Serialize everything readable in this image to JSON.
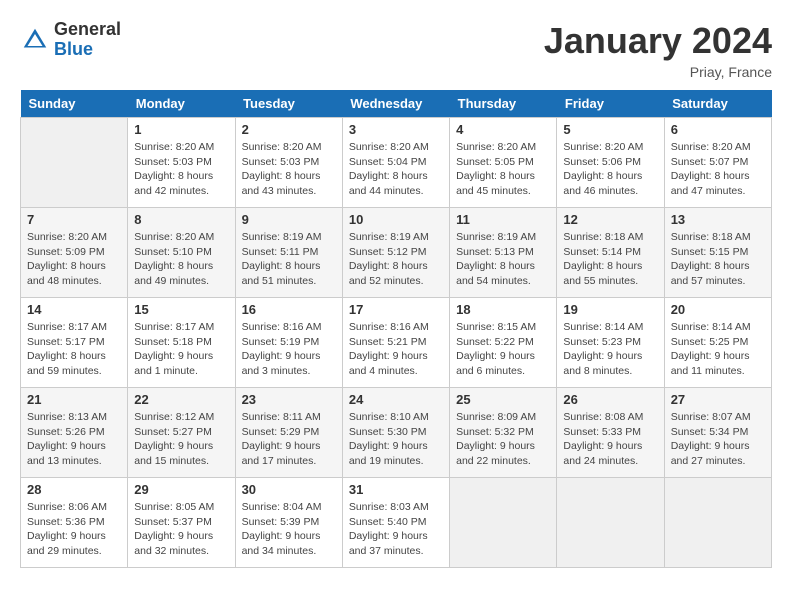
{
  "header": {
    "title": "January 2024",
    "location": "Priay, France",
    "logo_general": "General",
    "logo_blue": "Blue"
  },
  "days_of_week": [
    "Sunday",
    "Monday",
    "Tuesday",
    "Wednesday",
    "Thursday",
    "Friday",
    "Saturday"
  ],
  "weeks": [
    [
      {
        "date": "",
        "info": ""
      },
      {
        "date": "1",
        "info": "Sunrise: 8:20 AM\nSunset: 5:03 PM\nDaylight: 8 hours\nand 42 minutes."
      },
      {
        "date": "2",
        "info": "Sunrise: 8:20 AM\nSunset: 5:03 PM\nDaylight: 8 hours\nand 43 minutes."
      },
      {
        "date": "3",
        "info": "Sunrise: 8:20 AM\nSunset: 5:04 PM\nDaylight: 8 hours\nand 44 minutes."
      },
      {
        "date": "4",
        "info": "Sunrise: 8:20 AM\nSunset: 5:05 PM\nDaylight: 8 hours\nand 45 minutes."
      },
      {
        "date": "5",
        "info": "Sunrise: 8:20 AM\nSunset: 5:06 PM\nDaylight: 8 hours\nand 46 minutes."
      },
      {
        "date": "6",
        "info": "Sunrise: 8:20 AM\nSunset: 5:07 PM\nDaylight: 8 hours\nand 47 minutes."
      }
    ],
    [
      {
        "date": "7",
        "info": "Sunrise: 8:20 AM\nSunset: 5:09 PM\nDaylight: 8 hours\nand 48 minutes."
      },
      {
        "date": "8",
        "info": "Sunrise: 8:20 AM\nSunset: 5:10 PM\nDaylight: 8 hours\nand 49 minutes."
      },
      {
        "date": "9",
        "info": "Sunrise: 8:19 AM\nSunset: 5:11 PM\nDaylight: 8 hours\nand 51 minutes."
      },
      {
        "date": "10",
        "info": "Sunrise: 8:19 AM\nSunset: 5:12 PM\nDaylight: 8 hours\nand 52 minutes."
      },
      {
        "date": "11",
        "info": "Sunrise: 8:19 AM\nSunset: 5:13 PM\nDaylight: 8 hours\nand 54 minutes."
      },
      {
        "date": "12",
        "info": "Sunrise: 8:18 AM\nSunset: 5:14 PM\nDaylight: 8 hours\nand 55 minutes."
      },
      {
        "date": "13",
        "info": "Sunrise: 8:18 AM\nSunset: 5:15 PM\nDaylight: 8 hours\nand 57 minutes."
      }
    ],
    [
      {
        "date": "14",
        "info": "Sunrise: 8:17 AM\nSunset: 5:17 PM\nDaylight: 8 hours\nand 59 minutes."
      },
      {
        "date": "15",
        "info": "Sunrise: 8:17 AM\nSunset: 5:18 PM\nDaylight: 9 hours\nand 1 minute."
      },
      {
        "date": "16",
        "info": "Sunrise: 8:16 AM\nSunset: 5:19 PM\nDaylight: 9 hours\nand 3 minutes."
      },
      {
        "date": "17",
        "info": "Sunrise: 8:16 AM\nSunset: 5:21 PM\nDaylight: 9 hours\nand 4 minutes."
      },
      {
        "date": "18",
        "info": "Sunrise: 8:15 AM\nSunset: 5:22 PM\nDaylight: 9 hours\nand 6 minutes."
      },
      {
        "date": "19",
        "info": "Sunrise: 8:14 AM\nSunset: 5:23 PM\nDaylight: 9 hours\nand 8 minutes."
      },
      {
        "date": "20",
        "info": "Sunrise: 8:14 AM\nSunset: 5:25 PM\nDaylight: 9 hours\nand 11 minutes."
      }
    ],
    [
      {
        "date": "21",
        "info": "Sunrise: 8:13 AM\nSunset: 5:26 PM\nDaylight: 9 hours\nand 13 minutes."
      },
      {
        "date": "22",
        "info": "Sunrise: 8:12 AM\nSunset: 5:27 PM\nDaylight: 9 hours\nand 15 minutes."
      },
      {
        "date": "23",
        "info": "Sunrise: 8:11 AM\nSunset: 5:29 PM\nDaylight: 9 hours\nand 17 minutes."
      },
      {
        "date": "24",
        "info": "Sunrise: 8:10 AM\nSunset: 5:30 PM\nDaylight: 9 hours\nand 19 minutes."
      },
      {
        "date": "25",
        "info": "Sunrise: 8:09 AM\nSunset: 5:32 PM\nDaylight: 9 hours\nand 22 minutes."
      },
      {
        "date": "26",
        "info": "Sunrise: 8:08 AM\nSunset: 5:33 PM\nDaylight: 9 hours\nand 24 minutes."
      },
      {
        "date": "27",
        "info": "Sunrise: 8:07 AM\nSunset: 5:34 PM\nDaylight: 9 hours\nand 27 minutes."
      }
    ],
    [
      {
        "date": "28",
        "info": "Sunrise: 8:06 AM\nSunset: 5:36 PM\nDaylight: 9 hours\nand 29 minutes."
      },
      {
        "date": "29",
        "info": "Sunrise: 8:05 AM\nSunset: 5:37 PM\nDaylight: 9 hours\nand 32 minutes."
      },
      {
        "date": "30",
        "info": "Sunrise: 8:04 AM\nSunset: 5:39 PM\nDaylight: 9 hours\nand 34 minutes."
      },
      {
        "date": "31",
        "info": "Sunrise: 8:03 AM\nSunset: 5:40 PM\nDaylight: 9 hours\nand 37 minutes."
      },
      {
        "date": "",
        "info": ""
      },
      {
        "date": "",
        "info": ""
      },
      {
        "date": "",
        "info": ""
      }
    ]
  ]
}
